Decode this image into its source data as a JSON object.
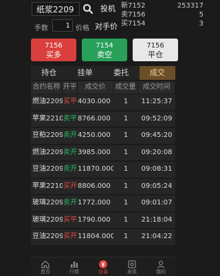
{
  "order": {
    "contract": "纸浆2209",
    "invest_label": "投机",
    "qty_label": "手数",
    "qty_value": "1",
    "price_label": "价格",
    "price_value": "对手价"
  },
  "quote": {
    "latest_label": "新",
    "latest_price": "7152",
    "volume": "253317",
    "ask_label": "卖",
    "ask_price": "7156",
    "ask_qty": "5",
    "bid_label": "买",
    "bid_price": "7154",
    "bid_qty": "3"
  },
  "actions": {
    "buy_price": "7156",
    "buy_label": "买多",
    "sell_price": "7154",
    "sell_label": "卖空",
    "close_price": "7156",
    "close_label": "平仓"
  },
  "tabs": [
    {
      "label": "持仓",
      "active": false
    },
    {
      "label": "挂单",
      "active": false
    },
    {
      "label": "委托",
      "active": false
    },
    {
      "label": "成交",
      "active": true
    }
  ],
  "table": {
    "headers": [
      "合约名称",
      "开平",
      "成交价",
      "成交量",
      "成交时间"
    ],
    "rows": [
      {
        "contract": "燃油2209",
        "action": "买平",
        "price": "4030.000",
        "qty": "1",
        "time": "11:25:37"
      },
      {
        "contract": "苹果2210",
        "action": "卖平",
        "price": "8766.000",
        "qty": "1",
        "time": "09:52:09"
      },
      {
        "contract": "豆粕2209",
        "action": "卖开",
        "price": "4250.000",
        "qty": "1",
        "time": "09:45:20"
      },
      {
        "contract": "燃油2209",
        "action": "卖开",
        "price": "3985.000",
        "qty": "1",
        "time": "09:20:08"
      },
      {
        "contract": "豆油2209",
        "action": "卖开",
        "price": "11870.000",
        "qty": "1",
        "time": "09:08:31"
      },
      {
        "contract": "苹果2210",
        "action": "买开",
        "price": "8806.000",
        "qty": "1",
        "time": "09:05:24"
      },
      {
        "contract": "玻璃2209",
        "action": "卖开",
        "price": "1772.000",
        "qty": "1",
        "time": "09:01:07"
      },
      {
        "contract": "玻璃2209",
        "action": "买平",
        "price": "1790.000",
        "qty": "1",
        "time": "21:18:04"
      },
      {
        "contract": "豆油2209",
        "action": "买开",
        "price": "11804.000",
        "qty": "1",
        "time": "21:04:22"
      }
    ]
  },
  "nav": [
    {
      "label": "首页",
      "icon": "home-icon",
      "active": false
    },
    {
      "label": "行情",
      "icon": "chart-bar-icon",
      "active": false
    },
    {
      "label": "交易",
      "icon": "yuan-coin-icon",
      "active": true
    },
    {
      "label": "发现",
      "icon": "discover-icon",
      "active": false
    },
    {
      "label": "我的",
      "icon": "user-icon",
      "active": false
    }
  ],
  "colors": {
    "buy": "#d9403d",
    "sell": "#28a05a",
    "close": "#e8e8e8",
    "tab_active": "#6b4f29",
    "text_red": "#e04a43",
    "text_green": "#2ab866"
  }
}
